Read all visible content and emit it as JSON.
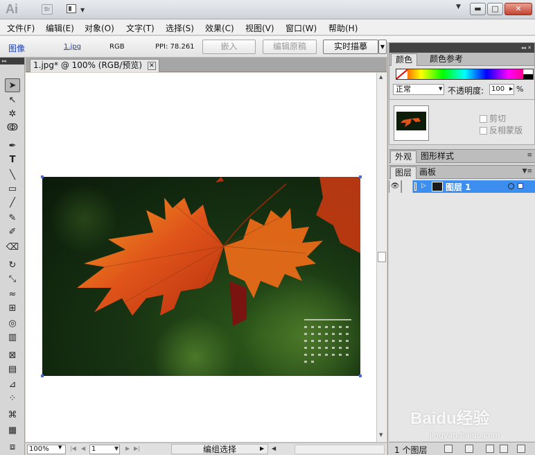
{
  "titlebar": {
    "app_logo": "Ai",
    "bridge_badge": "Br",
    "window_buttons": {
      "minimize": "▬",
      "maximize": "□",
      "close": "✕"
    }
  },
  "menu": {
    "items": [
      "文件(F)",
      "编辑(E)",
      "对象(O)",
      "文字(T)",
      "选择(S)",
      "效果(C)",
      "视图(V)",
      "窗口(W)",
      "帮助(H)"
    ]
  },
  "control_bar": {
    "object_type": "图像",
    "file_name": "1.jpg",
    "color_mode": "RGB",
    "ppi": "PPI: 78.261",
    "embed_label": "嵌入",
    "edit_original_label": "编辑原稿",
    "live_trace_label": "实时描摹"
  },
  "document": {
    "tab_title": "1.jpg* @ 100% (RGB/预览)",
    "tab_close": "✕"
  },
  "status_bar": {
    "zoom": "100%",
    "page": "1",
    "status_text": "编组选择"
  },
  "panels": {
    "color_tabs": [
      "颜色",
      "颜色参考"
    ],
    "blend_mode": "正常",
    "opacity_label": "不透明度:",
    "opacity_value": "100",
    "opacity_unit": "%",
    "clip_label": "剪切",
    "invert_mask_label": "反相蒙版",
    "appearance_tabs": [
      "外观",
      "图形样式"
    ],
    "layers_tabs": [
      "图层",
      "画板"
    ],
    "layer_name": "图层 1",
    "layers_count": "1 个图层"
  },
  "watermark": {
    "logo": "Baidu经验",
    "url": "jingyan.baidu.com"
  },
  "colors": {
    "selection": "#4a6cd6",
    "layer_highlight": "#3d8fef",
    "close_button": "#c4412f"
  }
}
